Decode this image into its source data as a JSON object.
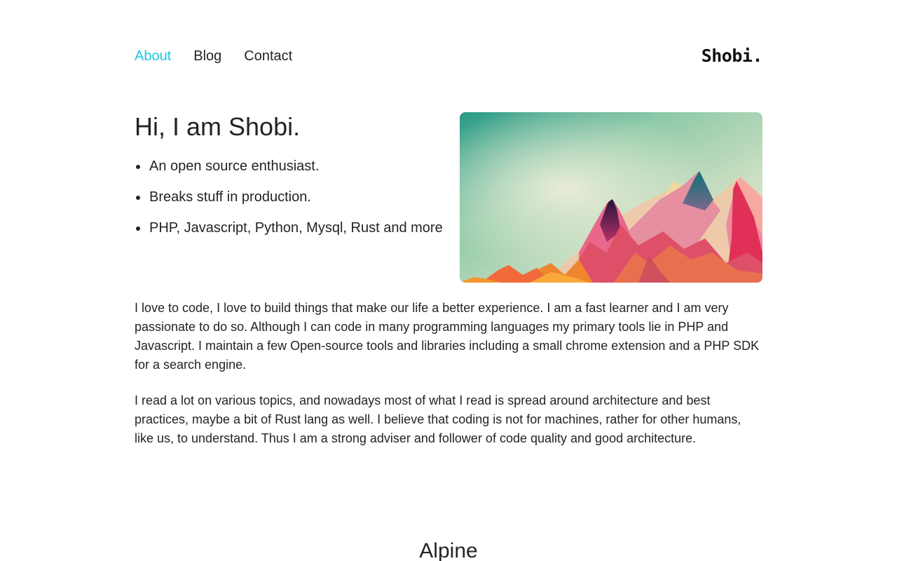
{
  "nav": {
    "links": [
      {
        "label": "About"
      },
      {
        "label": "Blog"
      },
      {
        "label": "Contact"
      }
    ],
    "logo": "Shobi."
  },
  "hero": {
    "title": "Hi, I am Shobi.",
    "bullets": [
      "An open source enthusiast.",
      "Breaks stuff in production.",
      "PHP, Javascript, Python, Mysql, Rust and more"
    ]
  },
  "about": {
    "paragraph_1": "I love to code, I love to build things that make our life a better experience. I am a fast learner and I am very passionate to do so. Although I can code in many programming languages my primary tools lie in PHP and Javascript. I maintain a few Open-source tools and libraries including a small chrome extension and a PHP SDK for a search engine.",
    "paragraph_2": "I read a lot on various topics, and nowadays most of what I read is spread around architecture and best practices, maybe a bit of Rust lang as well. I believe that coding is not for machines, rather for other humans, like us, to understand. Thus I am a strong adviser and follower of code quality and good architecture."
  },
  "section": {
    "title": "Alpine"
  },
  "colors": {
    "accent": "#1ec8e0",
    "text": "#242424"
  }
}
